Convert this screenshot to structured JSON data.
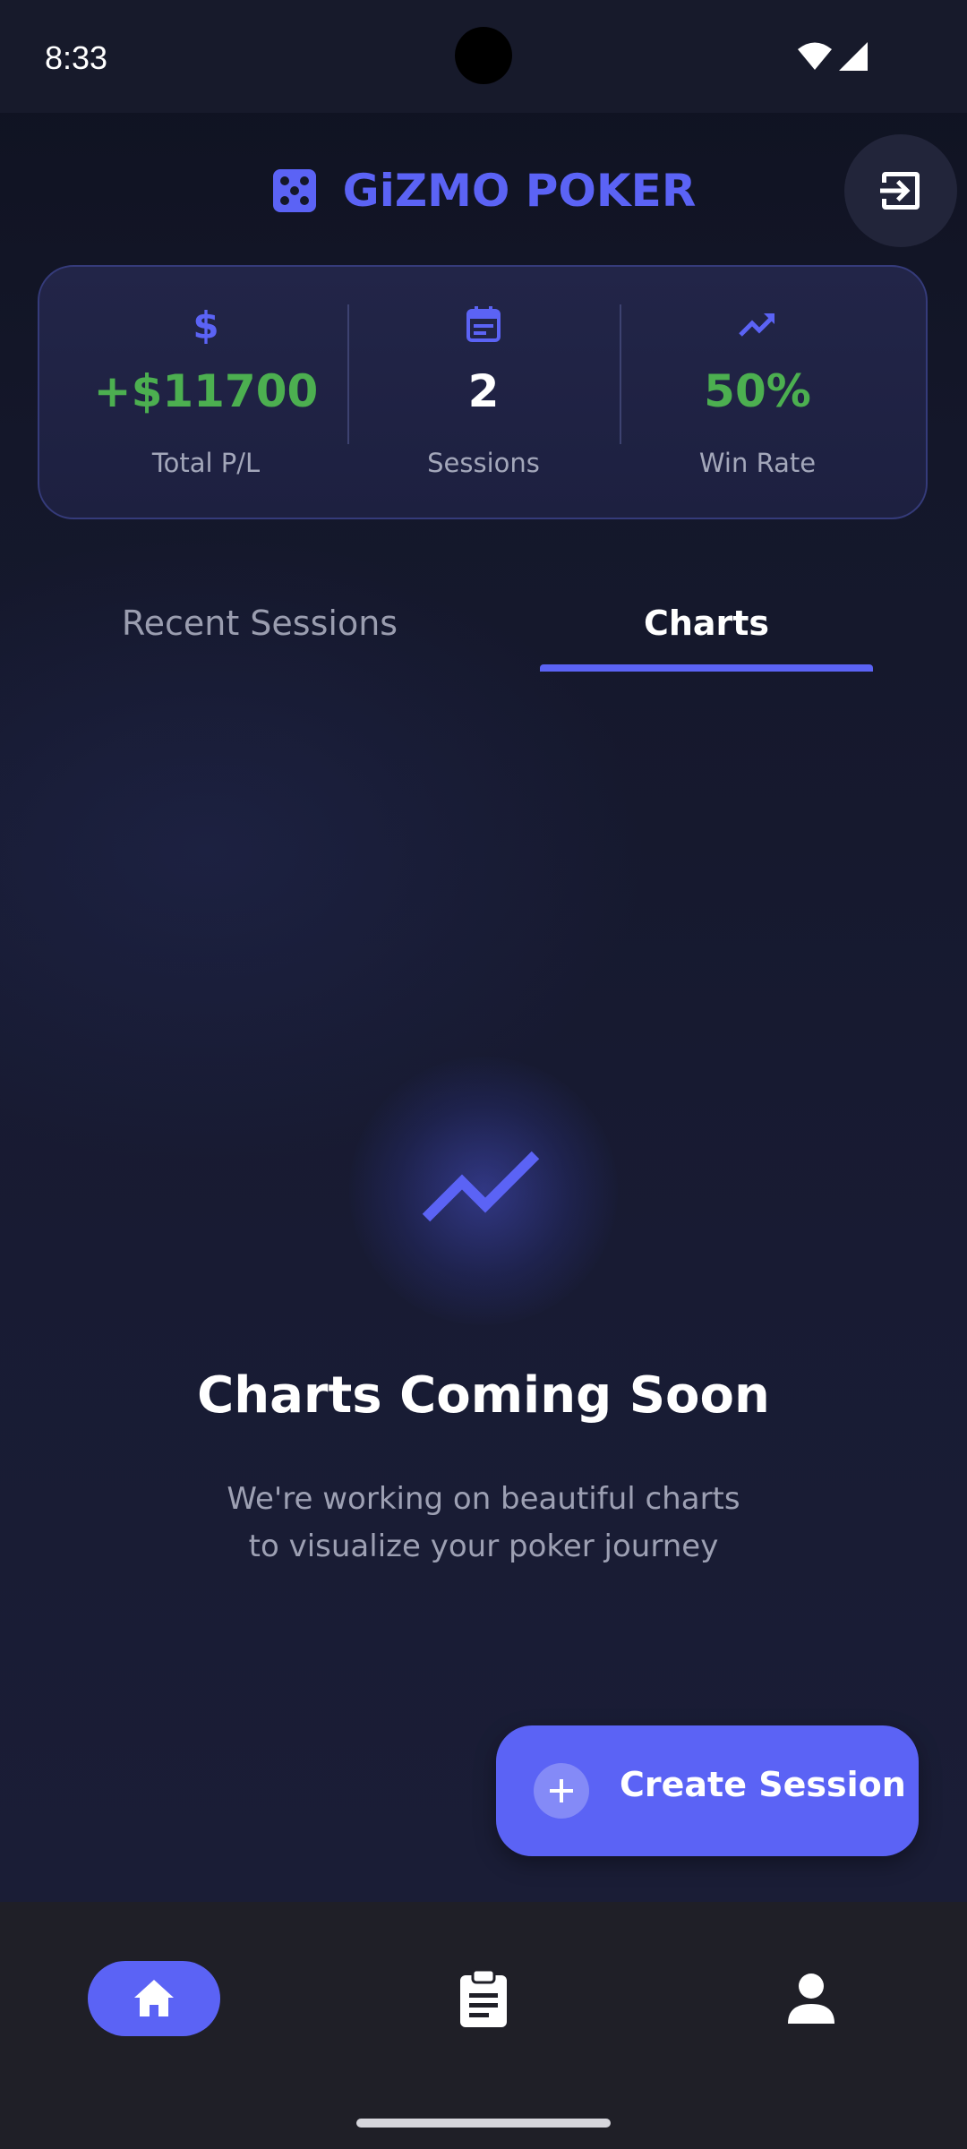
{
  "status_bar": {
    "time": "8:33",
    "icons": [
      "wifi-icon",
      "signal-icon"
    ]
  },
  "header": {
    "title": "GiZMO POKER",
    "logo_icon": "dice-icon",
    "logout_icon": "logout-icon"
  },
  "stats": [
    {
      "icon": "dollar-icon",
      "value": "+$11700",
      "label": "Total P/L",
      "color": "#4caf50"
    },
    {
      "icon": "calendar-icon",
      "value": "2",
      "label": "Sessions",
      "color": "#ffffff"
    },
    {
      "icon": "trending-up-icon",
      "value": "50%",
      "label": "Win Rate",
      "color": "#4caf50"
    }
  ],
  "tabs": {
    "items": [
      {
        "label": "Recent Sessions",
        "active": false
      },
      {
        "label": "Charts",
        "active": true
      }
    ]
  },
  "empty_state": {
    "icon": "trending-up-icon",
    "title": "Charts Coming Soon",
    "line1": "We're working on beautiful charts",
    "line2": "to visualize your poker journey"
  },
  "fab": {
    "icon": "plus-icon",
    "label": "Create Session"
  },
  "bottom_nav": {
    "items": [
      {
        "icon": "home-icon",
        "active": true
      },
      {
        "icon": "clipboard-icon",
        "active": false
      },
      {
        "icon": "person-icon",
        "active": false
      }
    ]
  },
  "colors": {
    "accent": "#5b63f5",
    "positive": "#4caf50",
    "background": "#14172a",
    "nav_background": "#1f1f27"
  }
}
